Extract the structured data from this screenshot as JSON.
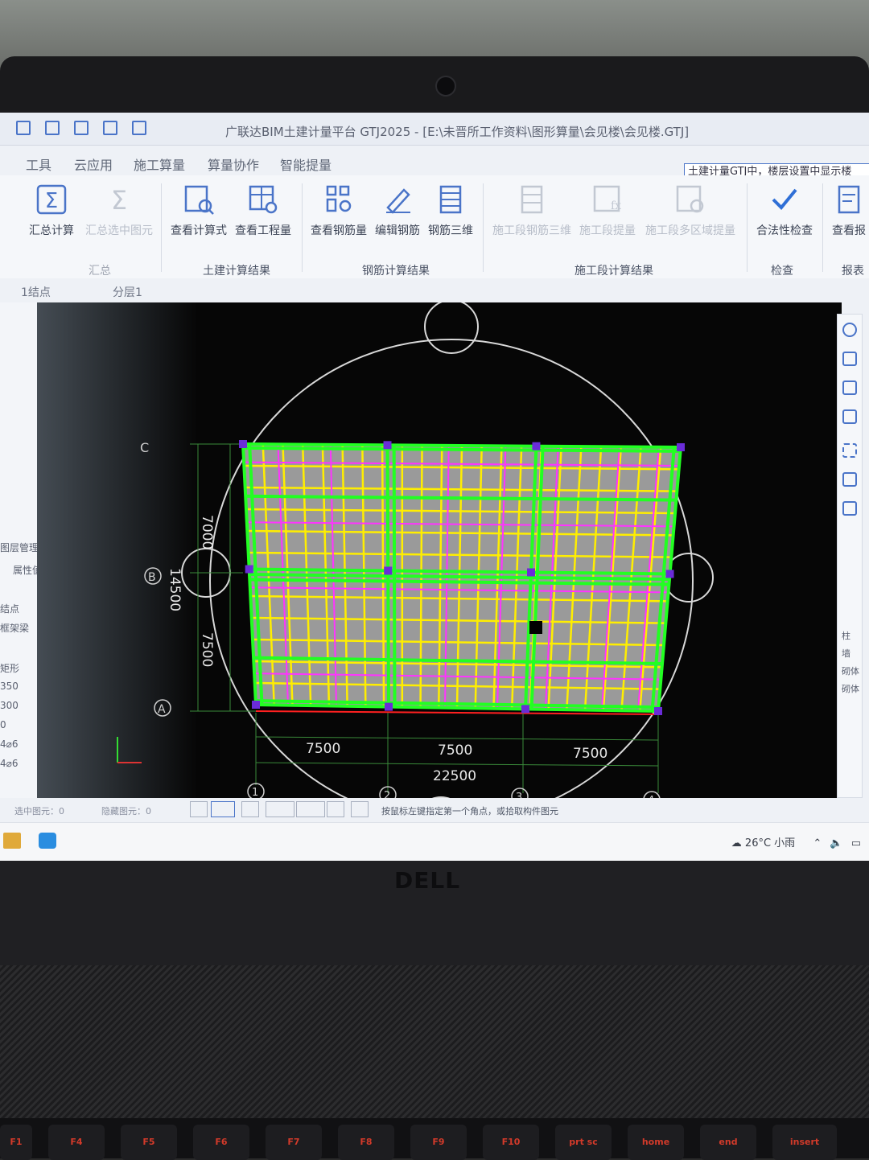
{
  "window": {
    "title": "广联达BIM土建计量平台 GTJ2025 - [E:\\未晋所工作资料\\图形算量\\会见楼\\会见楼.GTJ]"
  },
  "menu": [
    "工具",
    "云应用",
    "施工算量",
    "算量协作",
    "智能提量"
  ],
  "hint_box": "土建计量GTJ中，楼层设置中显示楼",
  "ribbon": {
    "buttons": [
      {
        "label": "汇总计算",
        "icon": "sigma-icon",
        "disabled": false
      },
      {
        "label": "汇总选中图元",
        "icon": "sigma-select-icon",
        "disabled": true
      },
      {
        "label": "查看计算式",
        "icon": "view-formula-icon",
        "disabled": false
      },
      {
        "label": "查看工程量",
        "icon": "view-quantity-icon",
        "disabled": false
      },
      {
        "label": "查看钢筋量",
        "icon": "view-rebar-icon",
        "disabled": false
      },
      {
        "label": "编辑钢筋",
        "icon": "edit-rebar-icon",
        "disabled": false
      },
      {
        "label": "钢筋三维",
        "icon": "rebar-3d-icon",
        "disabled": false
      },
      {
        "label": "施工段钢筋三维",
        "icon": "segment-rebar-3d-icon",
        "disabled": true
      },
      {
        "label": "施工段提量",
        "icon": "segment-quantity-icon",
        "disabled": true
      },
      {
        "label": "施工段多区域提量",
        "icon": "segment-multi-icon",
        "disabled": true
      },
      {
        "label": "合法性检查",
        "icon": "check-icon",
        "disabled": false
      },
      {
        "label": "查看报",
        "icon": "report-icon",
        "disabled": false
      }
    ],
    "groups": [
      "汇总",
      "土建计算结果",
      "钢筋计算结果",
      "施工段计算结果",
      "检查",
      "报表"
    ]
  },
  "layerbar": {
    "floor": "1结点",
    "layer": "分层1"
  },
  "left_panel": {
    "rows": [
      "图层管理",
      "属性值",
      "结点",
      "框架梁",
      "矩形",
      "350",
      "300",
      "0",
      "4⌀6",
      "4⌀6"
    ]
  },
  "right_panel": {
    "rows": [
      "柱",
      "墙",
      "砌体",
      "砌体"
    ]
  },
  "drawing": {
    "axes_h": [
      "C",
      "B",
      "A"
    ],
    "axes_v": [
      "1",
      "2",
      "3",
      "4"
    ],
    "dims_left": [
      "7000",
      "14500",
      "7500"
    ],
    "dims_bottom": [
      "7500",
      "7500",
      "7500",
      "22500"
    ]
  },
  "status": {
    "selected": "选中图元：0",
    "hidden": "隐藏图元：0",
    "prompt": "按鼠标左键指定第一个角点，或拾取构件图元"
  },
  "taskbar": {
    "weather": "26°C 小雨"
  },
  "laptop": {
    "brand": "DELL"
  },
  "keys": [
    "F1",
    "F4",
    "F5",
    "F6",
    "F7",
    "F8",
    "F9",
    "F10",
    "prt sc",
    "home",
    "end",
    "insert"
  ],
  "colors": {
    "accent": "#4a74c8",
    "beam_green": "#22ff22",
    "rebar_yellow": "#ffee00",
    "rebar_magenta": "#ff33ff",
    "slab_gray": "#9a9a9a"
  }
}
